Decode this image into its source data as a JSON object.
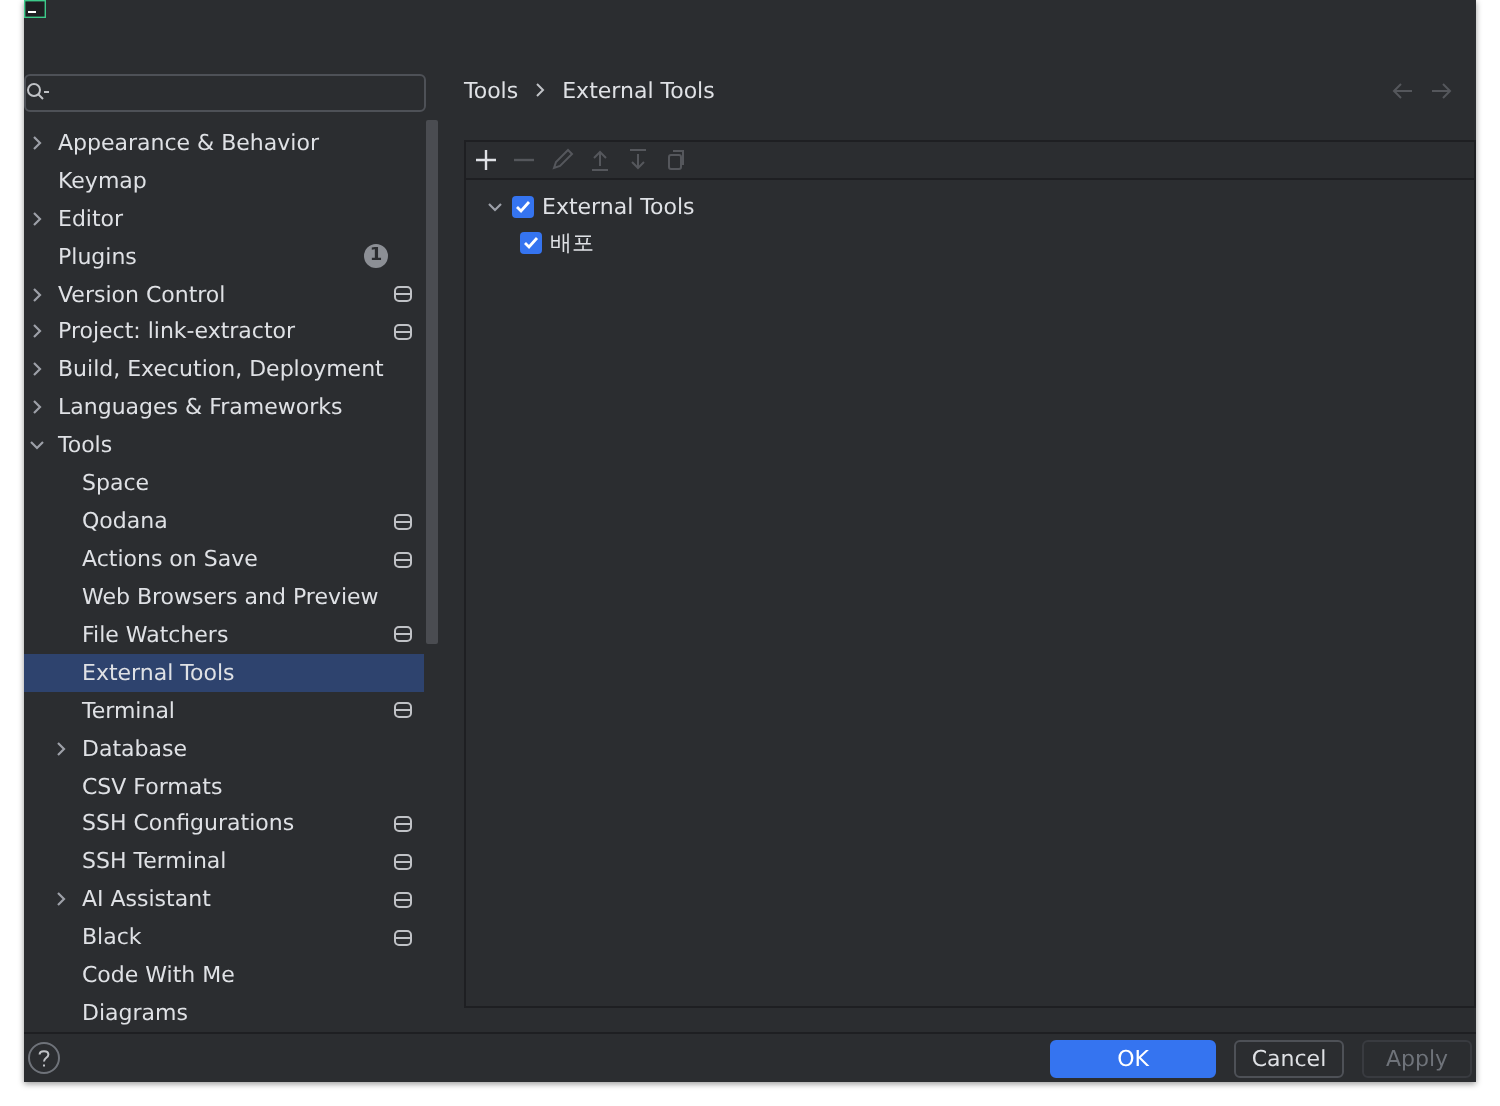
{
  "sidebar": {
    "items": [
      {
        "label": "Appearance & Behavior",
        "expanded": false,
        "scoped": false,
        "selected": false
      },
      {
        "label": "Keymap",
        "scoped": false,
        "selected": false
      },
      {
        "label": "Editor",
        "expanded": false,
        "scoped": false,
        "selected": false
      },
      {
        "label": "Plugins",
        "scoped": false,
        "badge": "1",
        "selected": false
      },
      {
        "label": "Version Control",
        "expanded": false,
        "scoped": true,
        "selected": false
      },
      {
        "label": "Project: link-extractor",
        "expanded": false,
        "scoped": true,
        "selected": false
      },
      {
        "label": "Build, Execution, Deployment",
        "expanded": false,
        "scoped": false,
        "selected": false
      },
      {
        "label": "Languages & Frameworks",
        "expanded": false,
        "scoped": false,
        "selected": false
      },
      {
        "label": "Tools",
        "expanded": true,
        "scoped": false,
        "selected": false,
        "children": [
          {
            "label": "Space",
            "scoped": false,
            "selected": false
          },
          {
            "label": "Qodana",
            "scoped": true,
            "selected": false
          },
          {
            "label": "Actions on Save",
            "scoped": true,
            "selected": false
          },
          {
            "label": "Web Browsers and Preview",
            "scoped": false,
            "selected": false
          },
          {
            "label": "File Watchers",
            "scoped": true,
            "selected": false
          },
          {
            "label": "External Tools",
            "scoped": false,
            "selected": true
          },
          {
            "label": "Terminal",
            "scoped": true,
            "selected": false
          },
          {
            "label": "Database",
            "expanded": false,
            "scoped": false,
            "selected": false
          },
          {
            "label": "CSV Formats",
            "scoped": false,
            "selected": false
          },
          {
            "label": "SSH Configurations",
            "scoped": true,
            "selected": false
          },
          {
            "label": "SSH Terminal",
            "scoped": true,
            "selected": false
          },
          {
            "label": "AI Assistant",
            "expanded": false,
            "scoped": true,
            "selected": false
          },
          {
            "label": "Black",
            "scoped": true,
            "selected": false
          },
          {
            "label": "Code With Me",
            "scoped": false,
            "selected": false
          },
          {
            "label": "Diagrams",
            "scoped": false,
            "selected": false
          }
        ]
      }
    ]
  },
  "content": {
    "breadcrumb": [
      "Tools",
      "External Tools"
    ],
    "toolbar": [
      {
        "kind": "add",
        "disabled": false
      },
      {
        "kind": "remove",
        "disabled": true
      },
      {
        "kind": "edit",
        "disabled": true
      },
      {
        "kind": "up",
        "disabled": true
      },
      {
        "kind": "down",
        "disabled": true
      },
      {
        "kind": "copy",
        "disabled": true
      }
    ],
    "tree": [
      {
        "label": "External Tools",
        "checked": true,
        "expanded": true,
        "children": [
          {
            "label": "배포",
            "checked": true
          }
        ]
      }
    ]
  },
  "buttons": [
    {
      "label": "OK",
      "kind": "primary",
      "disabled": false
    },
    {
      "label": "Cancel",
      "kind": "default",
      "disabled": false
    },
    {
      "label": "Apply",
      "kind": "default",
      "disabled": true
    }
  ]
}
